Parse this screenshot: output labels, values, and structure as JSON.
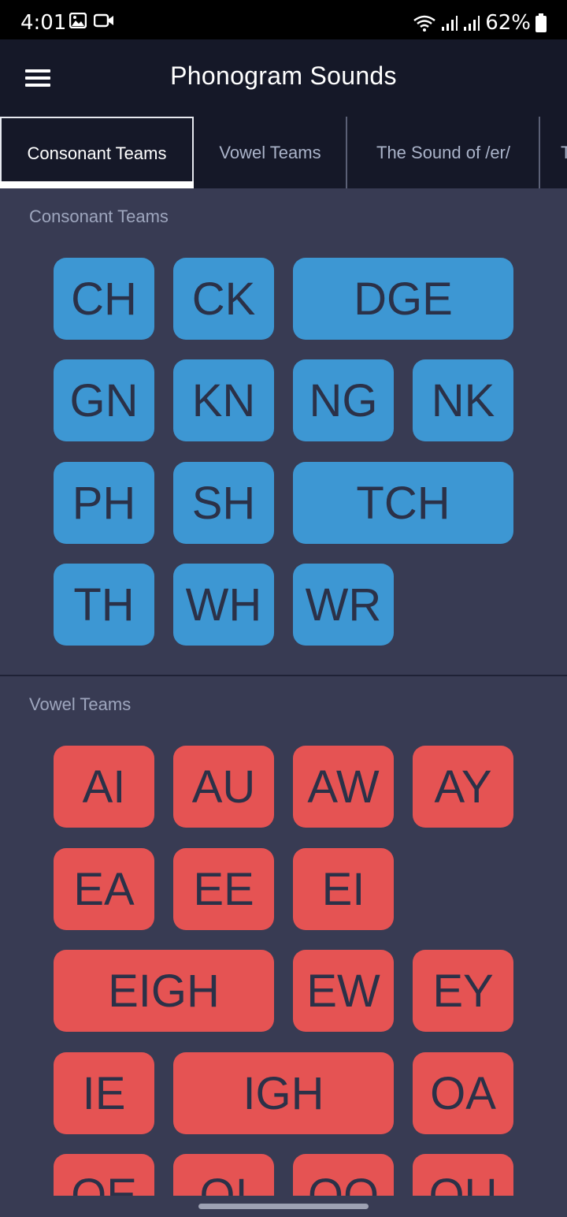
{
  "status_bar": {
    "time": "4:01",
    "battery": "62%"
  },
  "app_bar": {
    "title": "Phonogram Sounds"
  },
  "tabs": [
    {
      "label": "Consonant Teams"
    },
    {
      "label": "Vowel Teams"
    },
    {
      "label": "The Sound of /er/"
    },
    {
      "label": "T"
    }
  ],
  "sections": {
    "consonant": {
      "title": "Consonant Teams",
      "color": "#3d97d3",
      "tiles": [
        "CH",
        "CK",
        "DGE",
        "GN",
        "KN",
        "NG",
        "NK",
        "PH",
        "SH",
        "TCH",
        "TH",
        "WH",
        "WR"
      ]
    },
    "vowel": {
      "title": "Vowel Teams",
      "color": "#e55353",
      "tiles": [
        "AI",
        "AU",
        "AW",
        "AY",
        "EA",
        "EE",
        "EI",
        "EIGH",
        "EW",
        "EY",
        "IE",
        "IGH",
        "OA",
        "OE",
        "OI",
        "OO",
        "OU"
      ]
    }
  },
  "icons": [
    "image-icon",
    "video-icon",
    "wifi-icon",
    "signal-icon",
    "battery-icon",
    "menu-icon"
  ]
}
